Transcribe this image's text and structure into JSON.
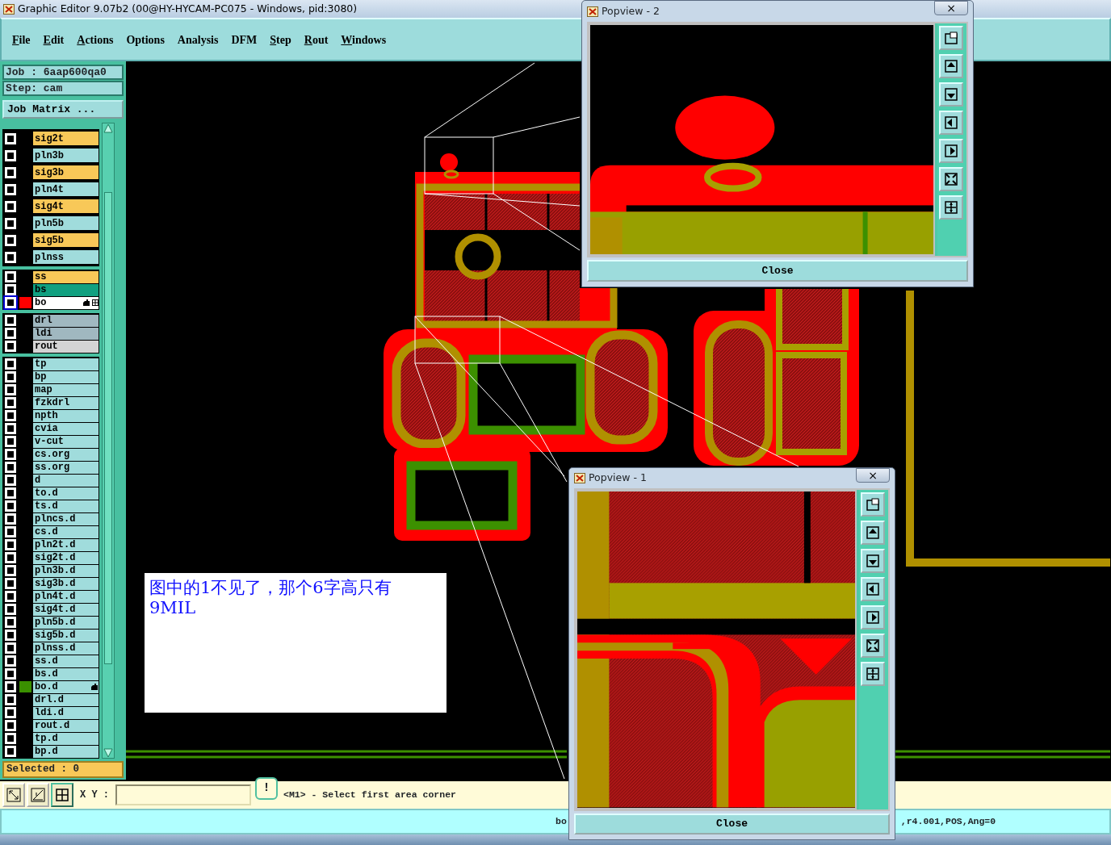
{
  "window": {
    "title": "Graphic Editor 9.07b2 (00@HY-HYCAM-PC075 - Windows, pid:3080)"
  },
  "menu": [
    {
      "label": "File",
      "mnemonic": true
    },
    {
      "label": "Edit",
      "mnemonic": true
    },
    {
      "label": "Actions",
      "mnemonic": true
    },
    {
      "label": "Options",
      "mnemonic": false
    },
    {
      "label": "Analysis",
      "mnemonic": false
    },
    {
      "label": "DFM",
      "mnemonic": false
    },
    {
      "label": "Step",
      "mnemonic": true
    },
    {
      "label": "Rout",
      "mnemonic": true
    },
    {
      "label": "Windows",
      "mnemonic": true
    }
  ],
  "job_panel": {
    "job": "Job : 6aap600qa0",
    "step": "Step: cam",
    "matrix_button": "Job Matrix ...",
    "layer_groups": [
      [
        {
          "name": "sig2t",
          "color": "#f8c858",
          "checked": false,
          "selected": false,
          "affected": false
        },
        {
          "name": "pln3b",
          "color": "#a0dcdc",
          "checked": false,
          "selected": false,
          "affected": false
        },
        {
          "name": "sig3b",
          "color": "#f8c858",
          "checked": false,
          "selected": false,
          "affected": false
        },
        {
          "name": "pln4t",
          "color": "#a0dcdc",
          "checked": false,
          "selected": false,
          "affected": false
        },
        {
          "name": "sig4t",
          "color": "#f8c858",
          "checked": false,
          "selected": false,
          "affected": false
        },
        {
          "name": "pln5b",
          "color": "#a0dcdc",
          "checked": false,
          "selected": false,
          "affected": false
        },
        {
          "name": "sig5b",
          "color": "#f8c858",
          "checked": false,
          "selected": false,
          "affected": false
        },
        {
          "name": "plnss",
          "color": "#a0dcdc",
          "checked": false,
          "selected": false,
          "affected": false
        }
      ],
      [
        {
          "name": "ss",
          "color": "#f8c858",
          "checked": false,
          "selected": false,
          "affected": false
        },
        {
          "name": "bs",
          "color": "#10a080",
          "checked": false,
          "selected": false,
          "affected": false
        },
        {
          "name": "bo",
          "color": "#ffffff",
          "checked": false,
          "selected": true,
          "affected": true,
          "swatch": {
            "color": "#ff0000"
          }
        }
      ],
      [
        {
          "name": "drl",
          "color": "#a0b8c0",
          "checked": false,
          "selected": false,
          "affected": false
        },
        {
          "name": "ldi",
          "color": "#a0b8c0",
          "checked": false,
          "selected": false,
          "affected": false
        },
        {
          "name": "rout",
          "color": "#d4d4d4",
          "checked": false,
          "selected": false,
          "affected": false
        }
      ],
      [
        {
          "name": "tp",
          "color": "#a0dcdc",
          "checked": false,
          "selected": false,
          "affected": false
        },
        {
          "name": "bp",
          "color": "#a0dcdc",
          "checked": false,
          "selected": false,
          "affected": false
        },
        {
          "name": "map",
          "color": "#a0dcdc",
          "checked": false,
          "selected": false,
          "affected": false
        },
        {
          "name": "fzkdrl",
          "color": "#a0dcdc",
          "checked": false,
          "selected": false,
          "affected": false
        },
        {
          "name": "npth",
          "color": "#a0dcdc",
          "checked": false,
          "selected": false,
          "affected": false
        },
        {
          "name": "cvia",
          "color": "#a0dcdc",
          "checked": false,
          "selected": false,
          "affected": false
        },
        {
          "name": "v-cut",
          "color": "#a0dcdc",
          "checked": false,
          "selected": false,
          "affected": false
        },
        {
          "name": "cs.org",
          "color": "#a0dcdc",
          "checked": false,
          "selected": false,
          "affected": false
        },
        {
          "name": "ss.org",
          "color": "#a0dcdc",
          "checked": false,
          "selected": false,
          "affected": false
        },
        {
          "name": "d",
          "color": "#a0dcdc",
          "checked": false,
          "selected": false,
          "affected": false
        },
        {
          "name": "to.d",
          "color": "#a0dcdc",
          "checked": false,
          "selected": false,
          "affected": false
        },
        {
          "name": "ts.d",
          "color": "#a0dcdc",
          "checked": false,
          "selected": false,
          "affected": false
        },
        {
          "name": "plncs.d",
          "color": "#a0dcdc",
          "checked": false,
          "selected": false,
          "affected": false
        },
        {
          "name": "cs.d",
          "color": "#a0dcdc",
          "checked": false,
          "selected": false,
          "affected": false
        },
        {
          "name": "pln2t.d",
          "color": "#a0dcdc",
          "checked": false,
          "selected": false,
          "affected": false
        },
        {
          "name": "sig2t.d",
          "color": "#a0dcdc",
          "checked": false,
          "selected": false,
          "affected": false
        },
        {
          "name": "pln3b.d",
          "color": "#a0dcdc",
          "checked": false,
          "selected": false,
          "affected": false
        },
        {
          "name": "sig3b.d",
          "color": "#a0dcdc",
          "checked": false,
          "selected": false,
          "affected": false
        },
        {
          "name": "pln4t.d",
          "color": "#a0dcdc",
          "checked": false,
          "selected": false,
          "affected": false
        },
        {
          "name": "sig4t.d",
          "color": "#a0dcdc",
          "checked": false,
          "selected": false,
          "affected": false
        },
        {
          "name": "pln5b.d",
          "color": "#a0dcdc",
          "checked": false,
          "selected": false,
          "affected": false
        },
        {
          "name": "sig5b.d",
          "color": "#a0dcdc",
          "checked": false,
          "selected": false,
          "affected": false
        },
        {
          "name": "plnss.d",
          "color": "#a0dcdc",
          "checked": false,
          "selected": false,
          "affected": false
        },
        {
          "name": "ss.d",
          "color": "#a0dcdc",
          "checked": false,
          "selected": false,
          "affected": false
        },
        {
          "name": "bs.d",
          "color": "#a0dcdc",
          "checked": false,
          "selected": false,
          "affected": false
        },
        {
          "name": "bo.d",
          "color": "#a0dcdc",
          "checked": false,
          "selected": false,
          "affected": true,
          "swatch": {
            "color": "#3a9000"
          }
        },
        {
          "name": "drl.d",
          "color": "#a0dcdc",
          "checked": false,
          "selected": false,
          "affected": false
        },
        {
          "name": "ldi.d",
          "color": "#a0dcdc",
          "checked": false,
          "selected": false,
          "affected": false
        },
        {
          "name": "rout.d",
          "color": "#a0dcdc",
          "checked": false,
          "selected": false,
          "affected": false
        },
        {
          "name": "tp.d",
          "color": "#a0dcdc",
          "checked": false,
          "selected": false,
          "affected": false
        },
        {
          "name": "bp.d",
          "color": "#a0dcdc",
          "checked": false,
          "selected": false,
          "affected": false
        }
      ]
    ],
    "selected_count": "Selected : 0"
  },
  "annotation": {
    "text": "图中的1不见了，那个6字高只有9MIL"
  },
  "toolbar": {
    "coord_label": "X Y :",
    "alert_glyph": "!",
    "message": "<M1> - Select first area corner"
  },
  "status_bar": {
    "segment_1": "bo",
    "segment_2": ",r4.001,POS,Ang=0"
  },
  "popviews": [
    {
      "title": "Popview - 2",
      "close_glyph": "×",
      "close_button": "Close"
    },
    {
      "title": "Popview - 1",
      "close_glyph": "×",
      "close_button": "Close"
    }
  ]
}
